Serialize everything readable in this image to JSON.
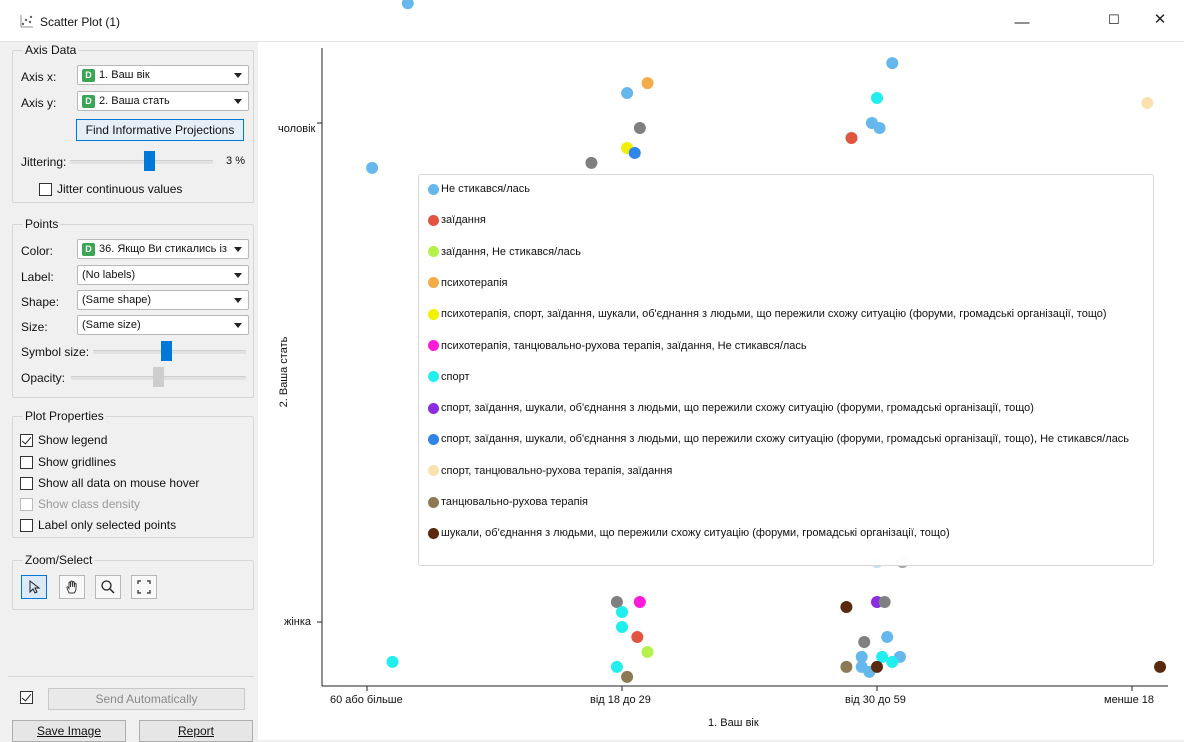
{
  "window": {
    "title": "Scatter Plot (1)",
    "minimize": "—",
    "maximize": "☐",
    "close": "✕"
  },
  "axis_data": {
    "group_title": "Axis Data",
    "x_label": "Axis x:",
    "x_value": "1. Ваш вік",
    "y_label": "Axis y:",
    "y_value": "2. Ваша стать",
    "find_button": "Find Informative Projections",
    "jittering_label": "Jittering:",
    "jittering_value": "3 %",
    "jittering_fraction": 0.55,
    "jitter_continuous_label": "Jitter continuous values",
    "jitter_continuous_checked": false
  },
  "points": {
    "group_title": "Points",
    "color_label": "Color:",
    "color_value": "36. Якщо Ви стикались із",
    "label_label": "Label:",
    "label_value": "(No labels)",
    "shape_label": "Shape:",
    "shape_value": "(Same shape)",
    "size_label": "Size:",
    "size_value": "(Same size)",
    "symbol_size_label": "Symbol size:",
    "symbol_size_fraction": 0.47,
    "opacity_label": "Opacity:",
    "opacity_fraction": 0.52
  },
  "plot_properties": {
    "group_title": "Plot Properties",
    "items": [
      {
        "label": "Show legend",
        "checked": true,
        "enabled": true
      },
      {
        "label": "Show gridlines",
        "checked": false,
        "enabled": true
      },
      {
        "label": "Show all data on mouse hover",
        "checked": false,
        "enabled": true
      },
      {
        "label": "Show class density",
        "checked": false,
        "enabled": false
      },
      {
        "label": "Label only selected points",
        "checked": false,
        "enabled": true
      }
    ]
  },
  "zoom_select": {
    "group_title": "Zoom/Select",
    "tools": [
      "pointer-icon",
      "hand-icon",
      "magnifier-icon",
      "fit-icon"
    ]
  },
  "bottom": {
    "send_auto": "Send Automatically",
    "send_auto_checked": true,
    "save_image": "Save Image",
    "report": "Report"
  },
  "chart_data": {
    "type": "scatter",
    "xlabel": "1. Ваш вік",
    "ylabel": "2. Ваша стать",
    "x_categories": [
      "60 або більше",
      "від 18 до 29",
      "від 30 до 59",
      "менше 18"
    ],
    "y_categories": [
      "жінка",
      "чоловік"
    ],
    "legend_placement": "center",
    "grid": false,
    "legend": [
      {
        "name": "Не стикався/лась",
        "color": "#66b8ec"
      },
      {
        "name": "заїдання",
        "color": "#e05540"
      },
      {
        "name": "заїдання, Не стикався/лась",
        "color": "#b6f04a"
      },
      {
        "name": "психотерапія",
        "color": "#f2ac4a"
      },
      {
        "name": "психотерапія, спорт, заїдання, шукали, об'єднання з людьми, що пережили схожу ситуацію (форуми, громадські організації, тощо)",
        "color": "#f0f000"
      },
      {
        "name": "психотерапія, танцювально-рухова терапія, заїдання, Не стикався/лась",
        "color": "#ff1cd8"
      },
      {
        "name": "спорт",
        "color": "#22eeee"
      },
      {
        "name": "спорт, заїдання, шукали, об'єднання з людьми, що пережили схожу ситуацію (форуми, громадські організації, тощо)",
        "color": "#8b2be2"
      },
      {
        "name": "спорт, заїдання, шукали, об'єднання з людьми, що пережили схожу ситуацію (форуми, громадські організації, тощо), Не стикався/лась",
        "color": "#2f86e8"
      },
      {
        "name": "спорт, танцювально-рухова терапія, заїдання",
        "color": "#fbe1b0"
      },
      {
        "name": "танцювально-рухова терапія",
        "color": "#8c7a55"
      },
      {
        "name": "шукали, об'єднання з людьми, що пережили схожу ситуацію (форуми, громадські організації, тощо)",
        "color": "#5a2a0e"
      }
    ],
    "points": [
      {
        "x": 0.16,
        "y": 1.24,
        "color": "#66b8ec"
      },
      {
        "x": 0.02,
        "y": 0.91,
        "color": "#66b8ec"
      },
      {
        "x": 0.1,
        "y": -0.08,
        "color": "#22eeee"
      },
      {
        "x": 1.02,
        "y": 1.06,
        "color": "#66b8ec"
      },
      {
        "x": 1.1,
        "y": 1.08,
        "color": "#f2ac4a"
      },
      {
        "x": 1.07,
        "y": 0.99,
        "color": "#808080"
      },
      {
        "x": 1.02,
        "y": 0.95,
        "color": "#f0f000"
      },
      {
        "x": 1.05,
        "y": 0.94,
        "color": "#2f86e8"
      },
      {
        "x": 0.88,
        "y": 0.92,
        "color": "#808080"
      },
      {
        "x": 0.98,
        "y": 0.04,
        "color": "#808080"
      },
      {
        "x": 1.07,
        "y": 0.04,
        "color": "#ff1cd8"
      },
      {
        "x": 1.0,
        "y": 0.02,
        "color": "#22eeee"
      },
      {
        "x": 1.0,
        "y": -0.01,
        "color": "#22eeee"
      },
      {
        "x": 1.06,
        "y": -0.03,
        "color": "#e05540"
      },
      {
        "x": 1.1,
        "y": -0.06,
        "color": "#b6f04a"
      },
      {
        "x": 0.98,
        "y": -0.09,
        "color": "#22eeee"
      },
      {
        "x": 1.02,
        "y": -0.11,
        "color": "#8c7a55"
      },
      {
        "x": 2.06,
        "y": 1.12,
        "color": "#66b8ec"
      },
      {
        "x": 2.0,
        "y": 1.05,
        "color": "#22eeee"
      },
      {
        "x": 1.98,
        "y": 1.0,
        "color": "#66b8ec"
      },
      {
        "x": 2.01,
        "y": 0.99,
        "color": "#66b8ec"
      },
      {
        "x": 1.9,
        "y": 0.97,
        "color": "#e05540"
      },
      {
        "x": 2.0,
        "y": 0.12,
        "color": "#bfe3f5"
      },
      {
        "x": 2.1,
        "y": 0.12,
        "color": "#aaaaaa"
      },
      {
        "x": 2.0,
        "y": 0.04,
        "color": "#8b2be2"
      },
      {
        "x": 2.03,
        "y": 0.04,
        "color": "#808080"
      },
      {
        "x": 1.88,
        "y": 0.03,
        "color": "#5a2a0e"
      },
      {
        "x": 2.04,
        "y": -0.03,
        "color": "#66b8ec"
      },
      {
        "x": 1.95,
        "y": -0.04,
        "color": "#808080"
      },
      {
        "x": 1.94,
        "y": -0.07,
        "color": "#66b8ec"
      },
      {
        "x": 2.02,
        "y": -0.07,
        "color": "#22eeee"
      },
      {
        "x": 2.09,
        "y": -0.07,
        "color": "#66b8ec"
      },
      {
        "x": 2.06,
        "y": -0.08,
        "color": "#22eeee"
      },
      {
        "x": 1.88,
        "y": -0.09,
        "color": "#8c7a55"
      },
      {
        "x": 1.94,
        "y": -0.09,
        "color": "#66b8ec"
      },
      {
        "x": 1.97,
        "y": -0.1,
        "color": "#66b8ec"
      },
      {
        "x": 2.0,
        "y": -0.09,
        "color": "#5a2a0e"
      },
      {
        "x": 3.06,
        "y": 1.04,
        "color": "#fbe1b0"
      },
      {
        "x": 3.11,
        "y": -0.09,
        "color": "#5a2a0e"
      }
    ]
  }
}
